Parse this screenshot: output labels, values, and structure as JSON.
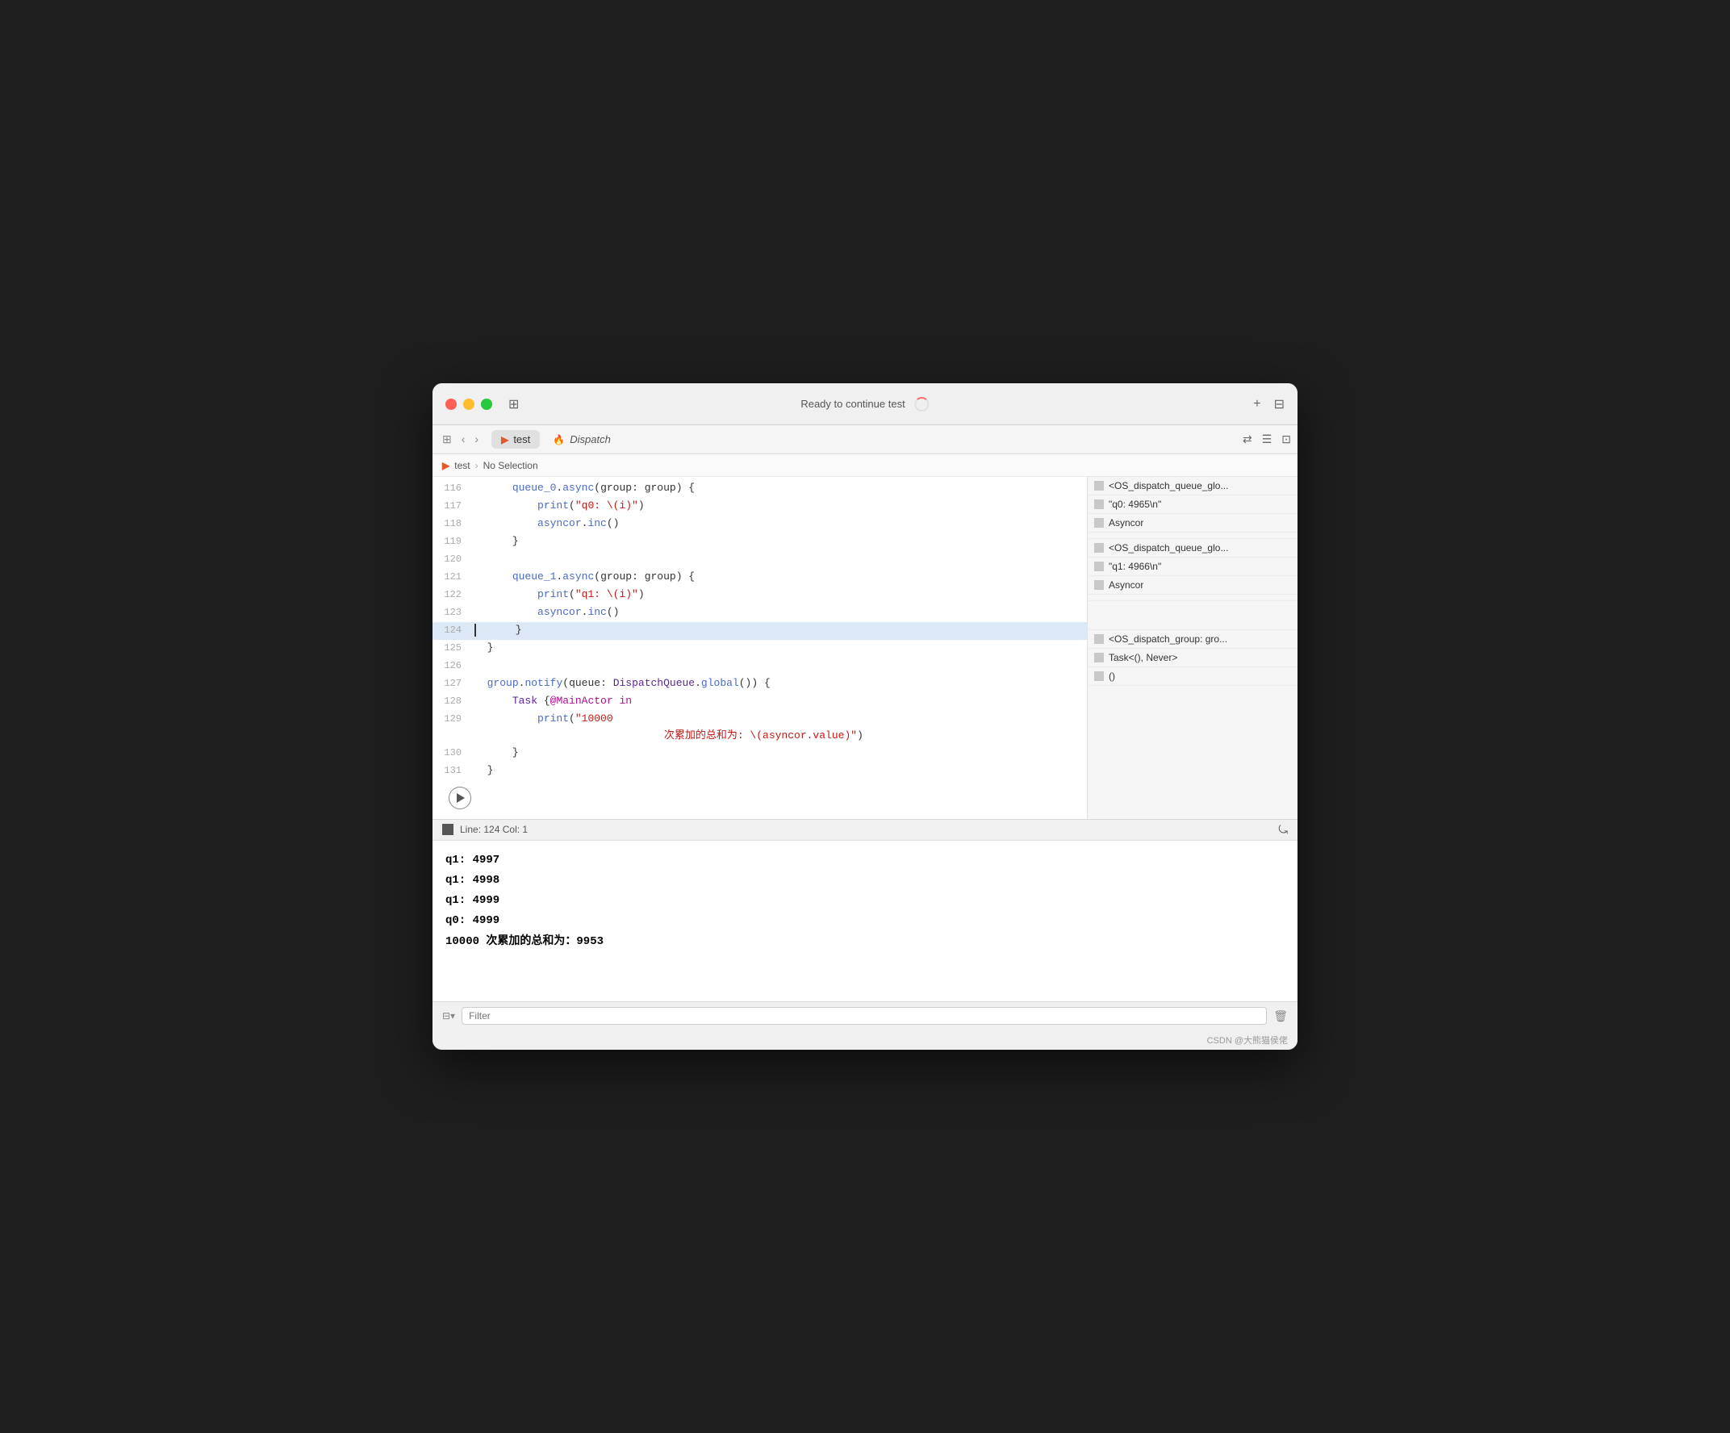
{
  "window": {
    "title": "Ready to continue test"
  },
  "tabs": [
    {
      "label": "test",
      "type": "swift",
      "active": true
    },
    {
      "label": "Dispatch",
      "type": "flame",
      "active": false
    }
  ],
  "breadcrumb": {
    "parts": [
      "test",
      "No Selection"
    ]
  },
  "code": {
    "lines": [
      {
        "num": "116",
        "tokens": [
          {
            "t": "      queue_0.async(group: group) {",
            "c": "mixed116"
          }
        ]
      },
      {
        "num": "117",
        "tokens": [
          {
            "t": "          print(\"q0: \\(i)\")",
            "c": "mixed117"
          }
        ]
      },
      {
        "num": "118",
        "tokens": [
          {
            "t": "          asyncor.inc()",
            "c": "mixed118"
          }
        ]
      },
      {
        "num": "119",
        "tokens": [
          {
            "t": "      }",
            "c": "plain"
          }
        ]
      },
      {
        "num": "120",
        "tokens": [
          {
            "t": "",
            "c": "plain"
          }
        ]
      },
      {
        "num": "121",
        "tokens": [
          {
            "t": "      queue_1.async(group: group) {",
            "c": "mixed121"
          }
        ]
      },
      {
        "num": "122",
        "tokens": [
          {
            "t": "          print(\"q1: \\(i)\")",
            "c": "mixed122"
          }
        ]
      },
      {
        "num": "123",
        "tokens": [
          {
            "t": "          asyncor.inc()",
            "c": "mixed123"
          }
        ]
      },
      {
        "num": "124",
        "tokens": [
          {
            "t": "      }",
            "c": "plain"
          }
        ],
        "highlighted": true
      },
      {
        "num": "125",
        "tokens": [
          {
            "t": "  }",
            "c": "plain"
          }
        ]
      },
      {
        "num": "126",
        "tokens": [
          {
            "t": "",
            "c": "plain"
          }
        ]
      },
      {
        "num": "127",
        "tokens": [
          {
            "t": "  group.notify(queue: DispatchQueue.global()) {",
            "c": "mixed127"
          }
        ]
      },
      {
        "num": "128",
        "tokens": [
          {
            "t": "      Task {@MainActor in",
            "c": "mixed128"
          }
        ]
      },
      {
        "num": "129",
        "tokens": [
          {
            "t": "          print(\"10000",
            "c": "mixed129a"
          },
          {
            "t": "\n                次累加的总和为: \\(asyncor.value)\")",
            "c": "mixed129b"
          }
        ]
      },
      {
        "num": "130",
        "tokens": [
          {
            "t": "      }",
            "c": "plain"
          }
        ]
      },
      {
        "num": "131",
        "tokens": [
          {
            "t": "  }",
            "c": "plain"
          }
        ]
      }
    ]
  },
  "right_panel": {
    "groups": [
      {
        "rows": [
          {
            "text": "<OS_dispatch_queue_glo..."
          },
          {
            "text": "\"q0: 4965\\n\""
          },
          {
            "text": "Asyncor"
          }
        ]
      },
      {
        "rows": [
          {
            "text": "<OS_dispatch_queue_glo..."
          },
          {
            "text": "\"q1: 4966\\n\""
          },
          {
            "text": "Asyncor"
          }
        ]
      },
      {
        "rows": [
          {
            "text": "<OS_dispatch_group: gro..."
          },
          {
            "text": "Task<(), Never>"
          },
          {
            "text": "()"
          }
        ]
      }
    ]
  },
  "statusbar": {
    "line": "Line: 124",
    "col": "Col: 1"
  },
  "console": {
    "lines": [
      "q1: 4997",
      "q1: 4998",
      "q1: 4999",
      "q0: 4999",
      "10000 次累加的总和为：9953"
    ]
  },
  "filterbar": {
    "placeholder": "Filter"
  },
  "attribution": "CSDN @大熊猫侯佬"
}
